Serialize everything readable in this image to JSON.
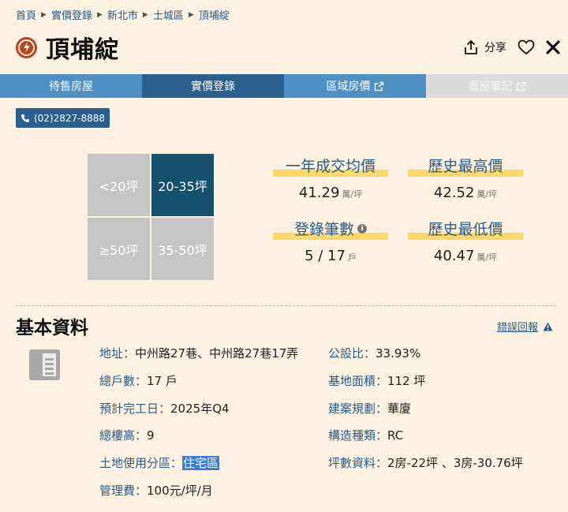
{
  "breadcrumb": [
    "首頁",
    "實價登錄",
    "新北市",
    "土城區",
    "頂埔綻"
  ],
  "title": "頂埔綻",
  "actions": {
    "share_label": "分享"
  },
  "tabs": [
    {
      "label": "待售房屋",
      "state": "normal"
    },
    {
      "label": "實價登錄",
      "state": "active"
    },
    {
      "label": "區域房價",
      "state": "external"
    },
    {
      "label": "看屋筆記",
      "state": "disabled"
    }
  ],
  "phone": "(02)2827-8888",
  "size_filters": [
    "<20坪",
    "20-35坪",
    "≥50坪",
    "35-50坪"
  ],
  "size_filter_active": "20-35坪",
  "stats": {
    "avg_label": "一年成交均價",
    "avg_value": "41.29",
    "avg_unit": "萬/坪",
    "max_label": "歷史最高價",
    "max_value": "42.52",
    "max_unit": "萬/坪",
    "count_label": "登錄筆數",
    "count_value": "5 / 17",
    "count_unit": "戶",
    "min_label": "歷史最低價",
    "min_value": "40.47",
    "min_unit": "萬/坪"
  },
  "basic": {
    "title": "基本資料",
    "report": "錯誤回報",
    "address_k": "地址：",
    "address_v": "中州路27巷、中州路27巷17弄",
    "households_k": "總戶數：",
    "households_v": "17 戶",
    "completion_k": "預計完工日：",
    "completion_v": "2025年Q4",
    "floors_k": "總樓高：",
    "floors_v": "9",
    "zoning_k": "土地使用分區：",
    "zoning_v": "住宅區",
    "fee_k": "管理費：",
    "fee_v": "100元/坪/月",
    "public_k": "公設比：",
    "public_v": "33.93%",
    "land_k": "基地面積：",
    "land_v": "112 坪",
    "plan_k": "建案規劃：",
    "plan_v": "華廈",
    "struct_k": "構造種類：",
    "struct_v": "RC",
    "layout_k": "坪數資料：",
    "layout_v": "2房-22坪 、3房-30.76坪"
  },
  "colors": {
    "background": "#fbf2e2",
    "tab": "#4e8fc6",
    "tab_active": "#2b5f8e",
    "highlight": "#ffd966",
    "link": "#2b5a8a",
    "logo": "#b8431c"
  }
}
